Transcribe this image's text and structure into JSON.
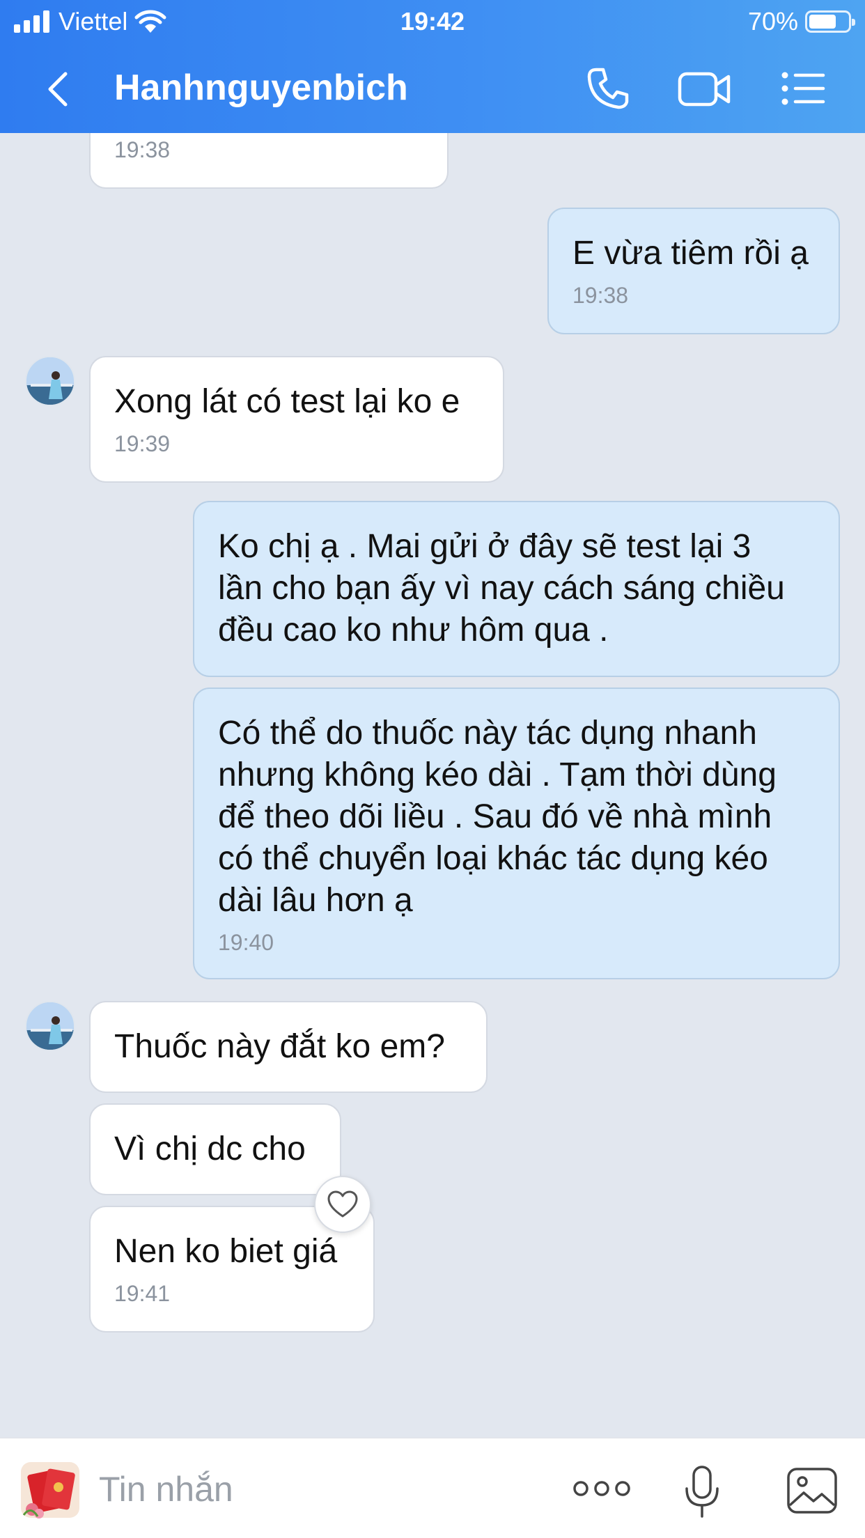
{
  "status_bar": {
    "carrier": "Viettel",
    "time": "19:42",
    "battery": "70%",
    "battery_level": 0.7
  },
  "header": {
    "contact_name": "Hanhnguyenbich",
    "icons": [
      "back-icon",
      "phone-icon",
      "video-icon",
      "list-menu-icon"
    ]
  },
  "messages": [
    {
      "side": "in",
      "text": "",
      "time": "19:38"
    },
    {
      "side": "out",
      "text": "E vừa tiêm rồi ạ",
      "time": "19:38"
    },
    {
      "side": "in",
      "text": "Xong lát có test lại ko e",
      "time": "19:39"
    },
    {
      "side": "out",
      "text": "Ko chị ạ . Mai gửi ở đây sẽ test lại 3\nlần cho bạn ấy vì nay cách sáng chiều\nđều cao ko như hôm qua .",
      "time": ""
    },
    {
      "side": "out",
      "text": "Có thể do thuốc này tác dụng nhanh\nnhưng không kéo dài . Tạm thời dùng\nđể theo dõi liều . Sau đó về nhà mình\ncó thể chuyển loại khác tác dụng kéo\ndài lâu hơn ạ",
      "time": "19:40"
    },
    {
      "side": "in",
      "text": "Thuốc này đắt ko em?",
      "time": ""
    },
    {
      "side": "in",
      "text": "Vì chị dc cho",
      "time": ""
    },
    {
      "side": "in",
      "text": "Nen ko biet giá",
      "time": "19:41"
    }
  ],
  "input": {
    "placeholder": "Tin nhắn",
    "icons": [
      "sticker-icon",
      "more-dots-icon",
      "microphone-icon",
      "image-gallery-icon"
    ]
  },
  "colors": {
    "header_start": "#2f7cf0",
    "header_end": "#4ea4f2",
    "chat_background": "#e2e7ef",
    "outgoing_bubble": "#d7eafb",
    "incoming_bubble": "#ffffff"
  }
}
